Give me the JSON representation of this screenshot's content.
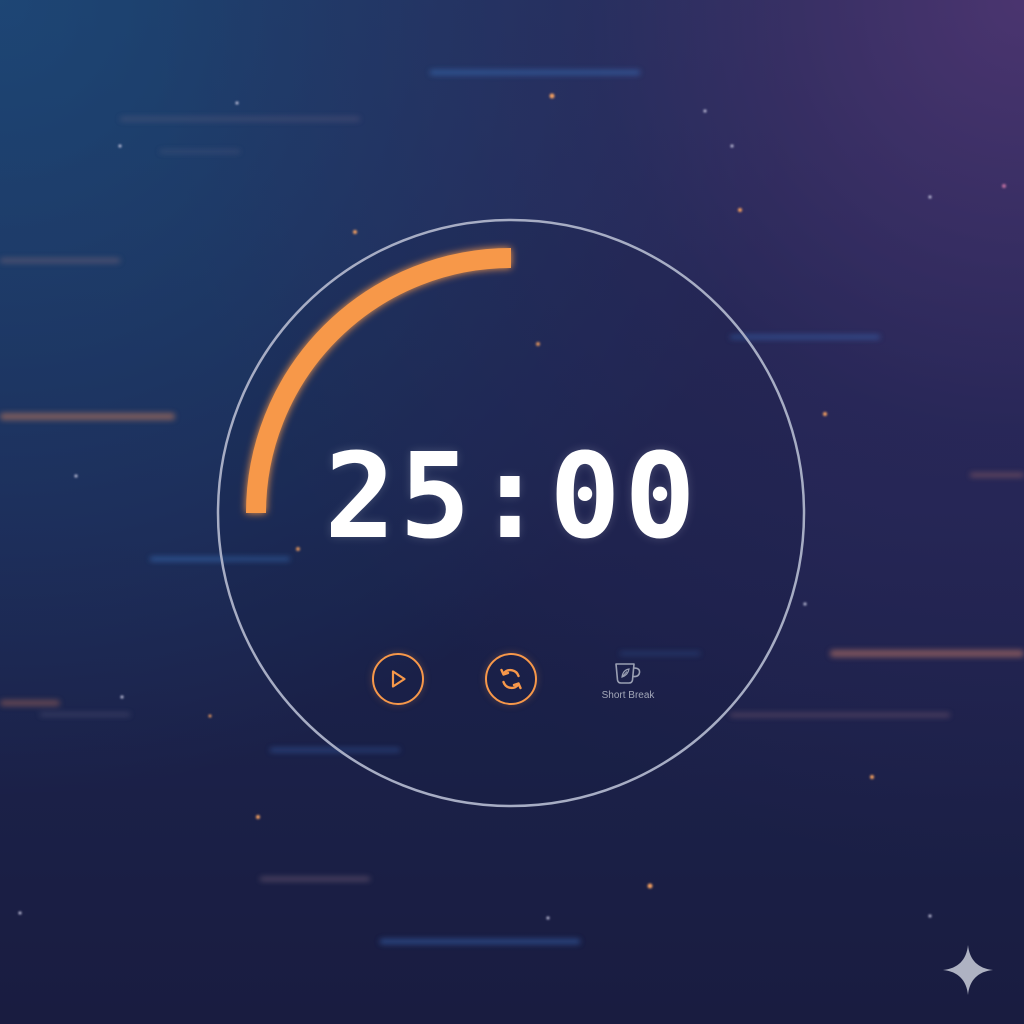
{
  "timer": {
    "display": "25:00",
    "progress": 0.25,
    "accent_color": "#f7984a",
    "ring_color": "#a7adc4"
  },
  "controls": {
    "play": {
      "icon": "play-icon"
    },
    "reset": {
      "icon": "refresh-icon"
    },
    "short_break": {
      "icon": "coffee-cup-icon",
      "label": "Short Break"
    }
  },
  "corner_mark": {
    "icon": "sparkle-icon"
  }
}
